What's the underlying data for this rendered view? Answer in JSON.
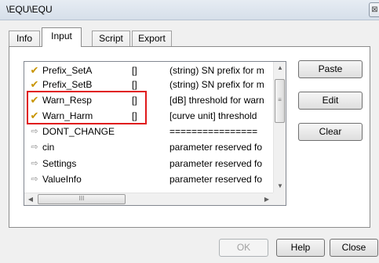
{
  "window": {
    "title": "\\EQU\\EQU",
    "close_glyph": "⊠"
  },
  "tabs": [
    {
      "label": "Info"
    },
    {
      "label": "Input",
      "active": true
    },
    {
      "label": "Script"
    },
    {
      "label": "Export"
    }
  ],
  "list": {
    "rows": [
      {
        "icon": "check-icon",
        "name": "Prefix_SetA",
        "value": "[]",
        "description": "(string) SN prefix for m"
      },
      {
        "icon": "check-icon",
        "name": "Prefix_SetB",
        "value": "[]",
        "description": "(string) SN prefix for m"
      },
      {
        "icon": "check-icon",
        "name": "Warn_Resp",
        "value": "[]",
        "description": "[dB] threshold for warn"
      },
      {
        "icon": "check-icon",
        "name": "Warn_Harm",
        "value": "[]",
        "description": "[curve unit] threshold"
      },
      {
        "icon": "arrow-right-icon",
        "name": "DONT_CHANGE",
        "value": "",
        "description": "================"
      },
      {
        "icon": "arrow-right-icon",
        "name": "cin",
        "value": "",
        "description": "parameter reserved fo"
      },
      {
        "icon": "arrow-right-icon",
        "name": "Settings",
        "value": "",
        "description": "parameter reserved fo"
      },
      {
        "icon": "arrow-right-icon",
        "name": "ValueInfo",
        "value": "",
        "description": "parameter reserved fo"
      }
    ],
    "hscroll_grip": "III"
  },
  "side_buttons": {
    "paste": "Paste",
    "edit": "Edit",
    "clear": "Clear"
  },
  "footer_buttons": {
    "ok": "OK",
    "help": "Help",
    "close": "Close"
  },
  "colors": {
    "highlight_border": "#e0191b",
    "check_icon": "#c89400"
  }
}
